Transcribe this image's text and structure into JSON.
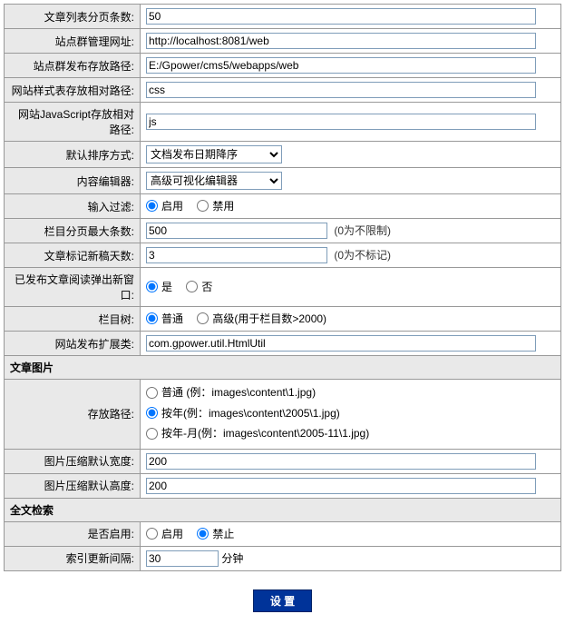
{
  "rows": {
    "page_size": {
      "label": "文章列表分页条数:",
      "value": "50"
    },
    "admin_url": {
      "label": "站点群管理网址:",
      "value": "http://localhost:8081/web"
    },
    "publish_path": {
      "label": "站点群发布存放路径:",
      "value": "E:/Gpower/cms5/webapps/web"
    },
    "css_path": {
      "label": "网站样式表存放相对路径:",
      "value": "css"
    },
    "js_path": {
      "label": "网站JavaScript存放相对路径:",
      "value": "js"
    },
    "sort": {
      "label": "默认排序方式:",
      "option": "文档发布日期降序"
    },
    "editor": {
      "label": "内容编辑器:",
      "option": "高级可视化编辑器"
    },
    "filter": {
      "label": "输入过滤:",
      "opt1": "启用",
      "opt2": "禁用"
    },
    "col_max": {
      "label": "栏目分页最大条数:",
      "value": "500",
      "note": "(0为不限制)"
    },
    "new_days": {
      "label": "文章标记新稿天数:",
      "value": "3",
      "note": "(0为不标记)"
    },
    "new_window": {
      "label": "已发布文章阅读弹出新窗口:",
      "opt1": "是",
      "opt2": "否"
    },
    "tree": {
      "label": "栏目树:",
      "opt1": "普通",
      "opt2": "高级(用于栏目数>2000)"
    },
    "ext_class": {
      "label": "网站发布扩展类:",
      "value": "com.gpower.util.HtmlUtil"
    }
  },
  "section_image": "文章图片",
  "image": {
    "store_path": {
      "label": "存放路径:",
      "opt1": "普通 (例：images\\content\\1.jpg)",
      "opt2": "按年(例：images\\content\\2005\\1.jpg)",
      "opt3": "按年-月(例：images\\content\\2005-11\\1.jpg)"
    },
    "width": {
      "label": "图片压缩默认宽度:",
      "value": "200"
    },
    "height": {
      "label": "图片压缩默认高度:",
      "value": "200"
    }
  },
  "section_fulltext": "全文检索",
  "fulltext": {
    "enable": {
      "label": "是否启用:",
      "opt1": "启用",
      "opt2": "禁止"
    },
    "interval": {
      "label": "索引更新间隔:",
      "value": "30",
      "unit": "分钟"
    }
  },
  "button": "设 置"
}
